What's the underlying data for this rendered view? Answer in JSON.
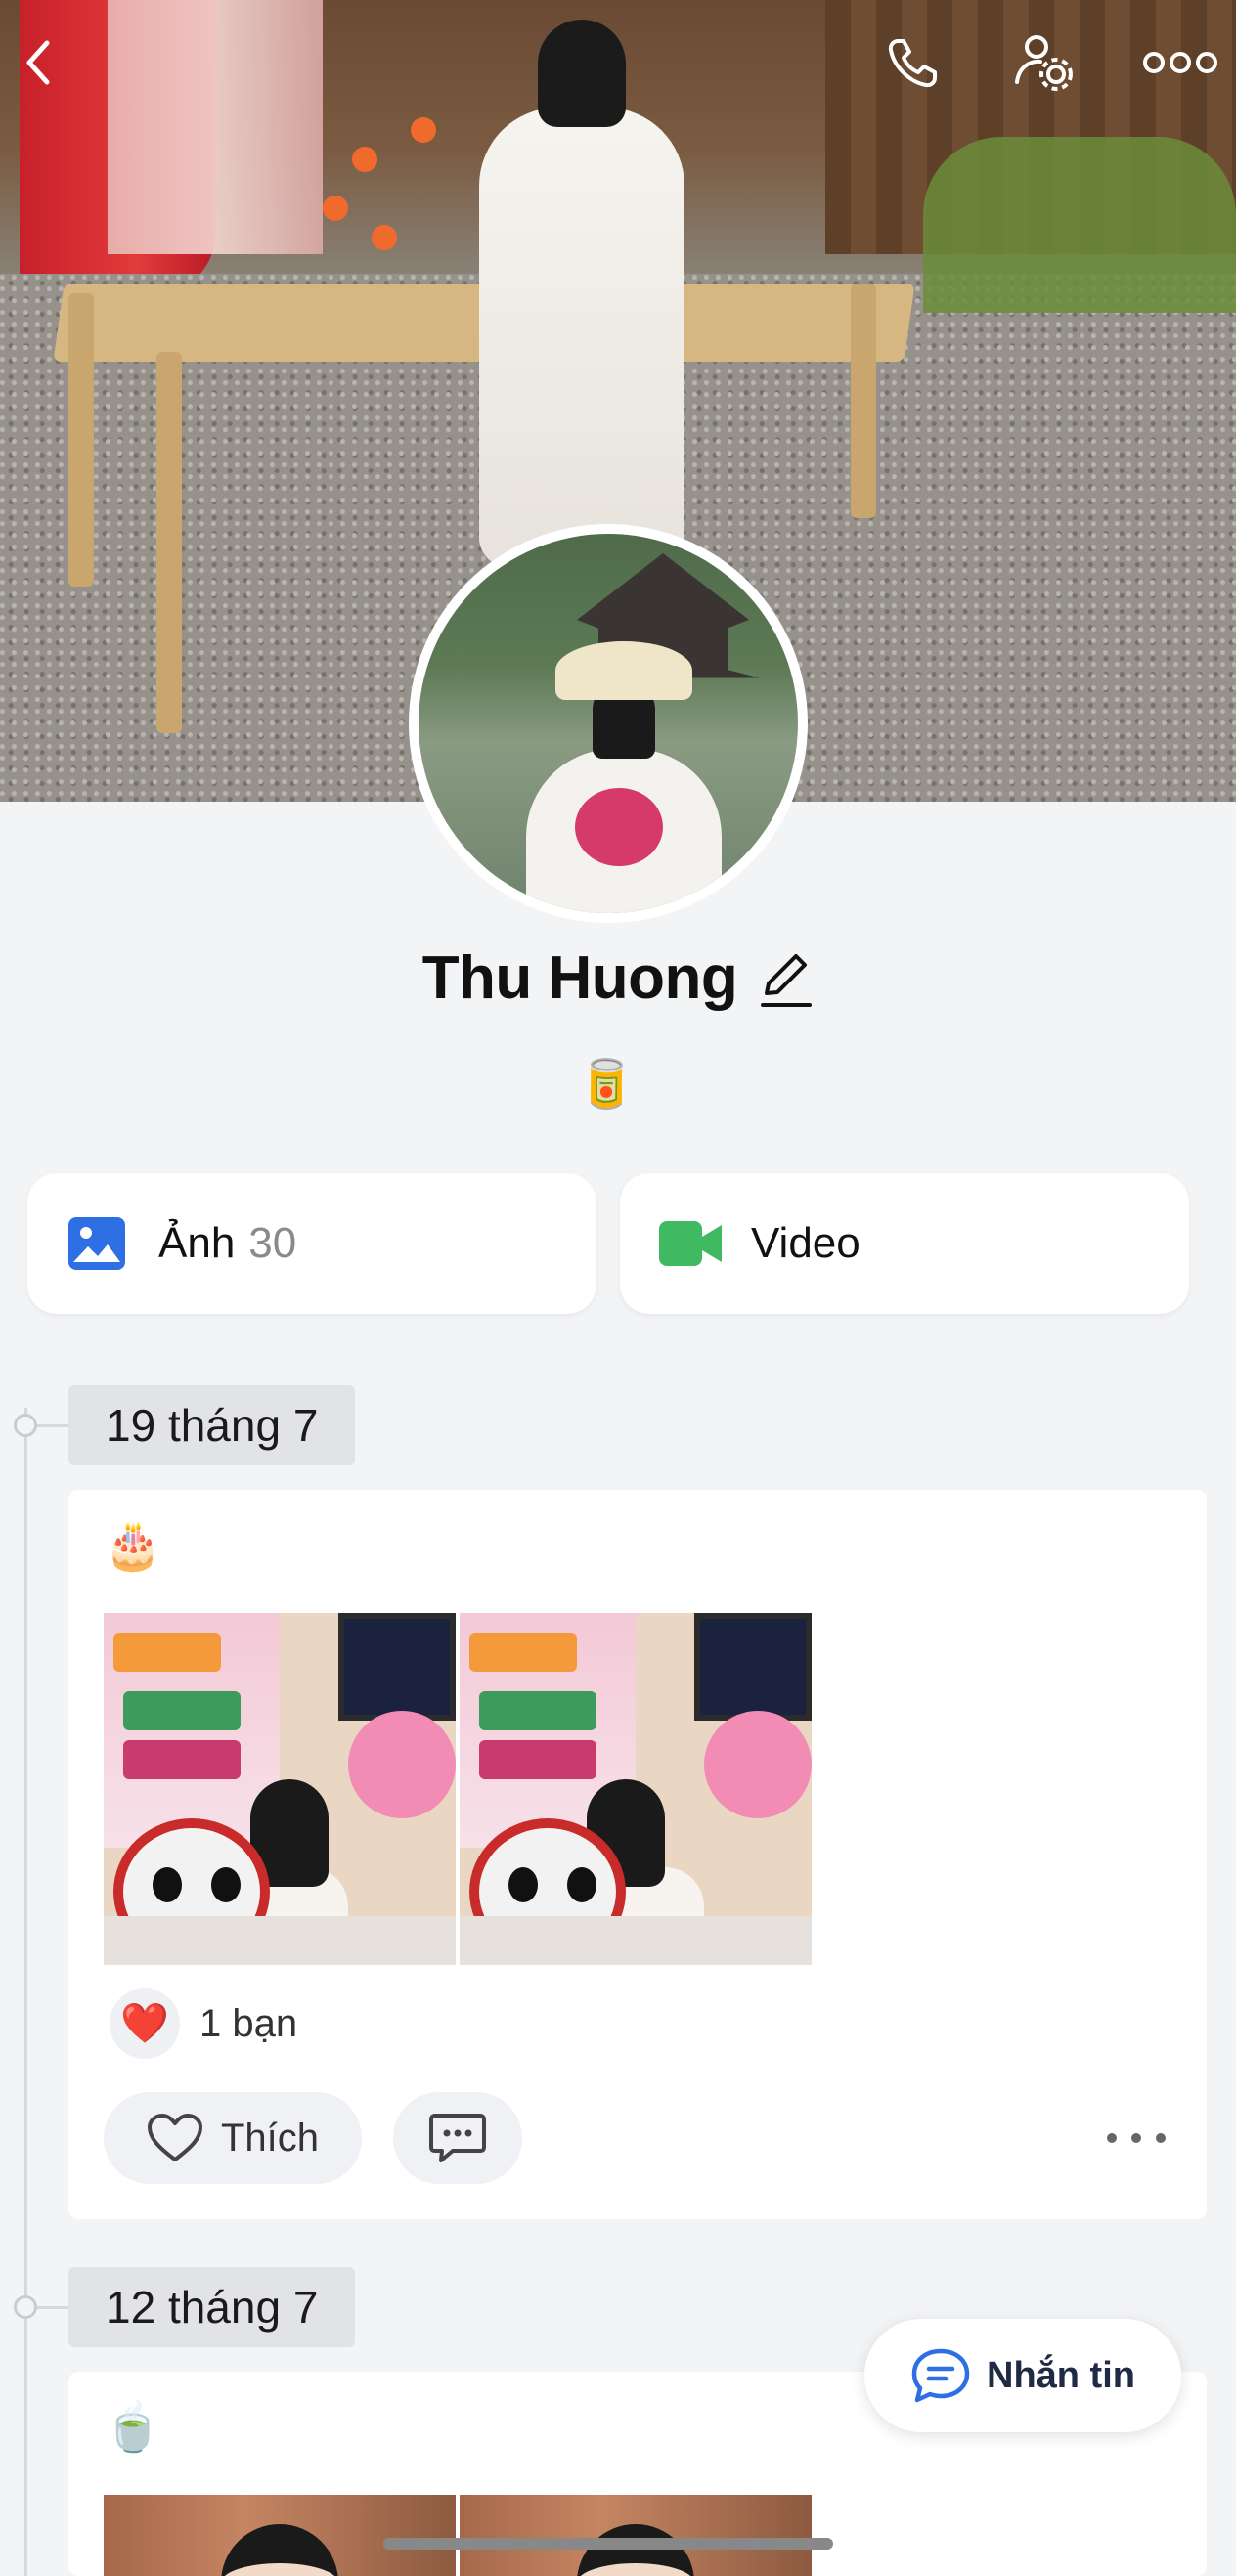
{
  "profile": {
    "name": "Thu Huong",
    "status_emoji": "🥫"
  },
  "media": {
    "photos_label": "Ảnh",
    "photos_count": "30",
    "video_label": "Video"
  },
  "icons": {
    "back": "chevron-left-icon",
    "call": "phone-icon",
    "settings": "user-settings-icon",
    "more": "more-horizontal-icon",
    "edit": "pencil-icon",
    "photos": "image-icon",
    "video": "video-camera-icon",
    "like": "heart-outline-icon",
    "comment": "comment-icon",
    "chat": "chat-bubble-icon"
  },
  "colors": {
    "photos_icon": "#2f6fe4",
    "video_icon": "#3fba63",
    "heart": "#e03142",
    "chat_icon": "#2f6fe4"
  },
  "posts": [
    {
      "date": "19 tháng 7",
      "emoji": "🎂",
      "reaction_emoji": "❤️",
      "reaction_text": "1 bạn",
      "like_label": "Thích"
    },
    {
      "date": "12 tháng 7",
      "emoji": "🍵"
    }
  ],
  "chat_button": {
    "label": "Nhắn tin"
  }
}
